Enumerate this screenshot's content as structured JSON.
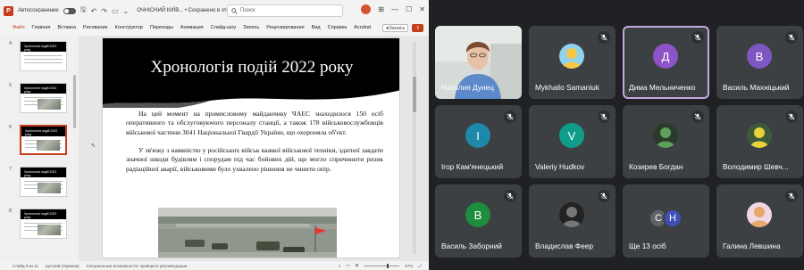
{
  "ppt": {
    "autosave_label": "Автосохранение",
    "doc_title": "ОЧНІСНИЙ КИЇВ... • Сохранено в этот компьютер",
    "search_placeholder": "Поиск",
    "menu": [
      "Файл",
      "Главная",
      "Вставка",
      "Рисование",
      "Конструктор",
      "Переходы",
      "Анимация",
      "Слайд-шоу",
      "Запись",
      "Рецензирование",
      "Вид",
      "Справка",
      "Acrobat"
    ],
    "active_menu_index": 0,
    "record_label": "Запись",
    "share_label": "",
    "thumbnails": [
      {
        "num": "4",
        "title": "Хронологія подій 2022 року"
      },
      {
        "num": "5",
        "title": "Хронологія подій 2022 року"
      },
      {
        "num": "6",
        "title": "Хронологія подій 2022 року"
      },
      {
        "num": "7",
        "title": "Хронологія подій 2022 року"
      },
      {
        "num": "8",
        "title": "Хронологія подій 2022 року"
      }
    ],
    "active_thumbnail_index": 2,
    "slide": {
      "title": "Хронологія подій 2022 року",
      "paragraph1": "На цей момент на промисловому майданчику ЧАЕС знаходилося 150 осіб оперативного та обслуговуючого персоналу станції, а також 178 військовослужбовців військової частини 3041 Національної Гвардії України, що охороняла об'єкт.",
      "paragraph2": "У зв'язку з наявністю у російських військ важкої військової техніки, здатної завдати значної шкоди будівлям і спорудам під час бойових дій, що могло спричинити ризик радіаційної аварії, військовими було ухвалено рішення не чинити опір."
    },
    "status": {
      "slide_counter": "Слайд 6 из 11",
      "language": "русский (Украина)",
      "accessibility": "Специальные возможности: проверьте рекомендации",
      "zoom": "57%"
    }
  },
  "meet": {
    "colors": {
      "tile": "#3c4043",
      "speaking_border": "#c2a8e0"
    },
    "participants": [
      {
        "name": "Наталия Дунец",
        "type": "video",
        "muted": false
      },
      {
        "name": "Mykhailo Samaniuk",
        "type": "photo",
        "muted": true
      },
      {
        "name": "Дима Мельниченко",
        "type": "letter",
        "letter": "Д",
        "avatar_color": "#8e53c9",
        "muted": true,
        "speaking": true
      },
      {
        "name": "Василь Махніцький",
        "type": "letter",
        "letter": "В",
        "avatar_color": "#7e57c2",
        "muted": true
      },
      {
        "name": "Ігор Кам'янецький",
        "type": "letter",
        "letter": "І",
        "avatar_color": "#1e88a8",
        "muted": true
      },
      {
        "name": "Valeriy Hudkov",
        "type": "letter",
        "letter": "V",
        "avatar_color": "#0f9d8a",
        "muted": true
      },
      {
        "name": "Козирев Богдан",
        "type": "photo",
        "muted": true
      },
      {
        "name": "Володимир Шевч...",
        "type": "photo",
        "muted": true
      },
      {
        "name": "Василь Заборний",
        "type": "letter",
        "letter": "В",
        "avatar_color": "#1e8e3e",
        "muted": true
      },
      {
        "name": "Владислав Феер",
        "type": "photo",
        "muted": true
      },
      {
        "name": "Ще 13 осіб",
        "type": "more",
        "letters": [
          "C",
          "Н"
        ],
        "muted": false
      },
      {
        "name": "Галина Левшина",
        "type": "photo",
        "muted": true
      }
    ]
  }
}
